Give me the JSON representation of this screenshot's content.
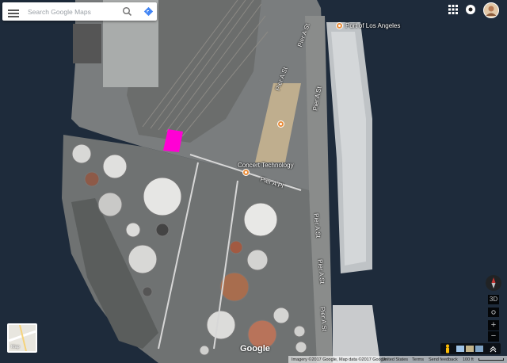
{
  "search": {
    "placeholder": "Search Google Maps"
  },
  "labels": {
    "port": "Port of Los Angeles",
    "concert": "Concert Technology",
    "pier_a_pl": "Pier A Pl",
    "pier_a_st_1": "Pier A St",
    "pier_a_st_2": "Pier A St",
    "pier_a_st_3": "Pier A St",
    "pier_a_st_4": "Pier A St",
    "pier_a_st_5": "Pier A St",
    "pier_a_st_6": "Pier A St"
  },
  "layer_thumb": {
    "label": "Map"
  },
  "branding": "Google",
  "footer": {
    "imagery": "Imagery ©2017 Google, Map data ©2017 Google",
    "country": "United States",
    "terms": "Terms",
    "feedback": "Send feedback",
    "scale": "100 ft"
  },
  "controls": {
    "view_3d": "3D",
    "zoom_in": "+",
    "zoom_out": "−"
  },
  "colors": {
    "highlight": "#ff00d4",
    "poi": "#e98d3a",
    "water": "#1f2d3d"
  }
}
